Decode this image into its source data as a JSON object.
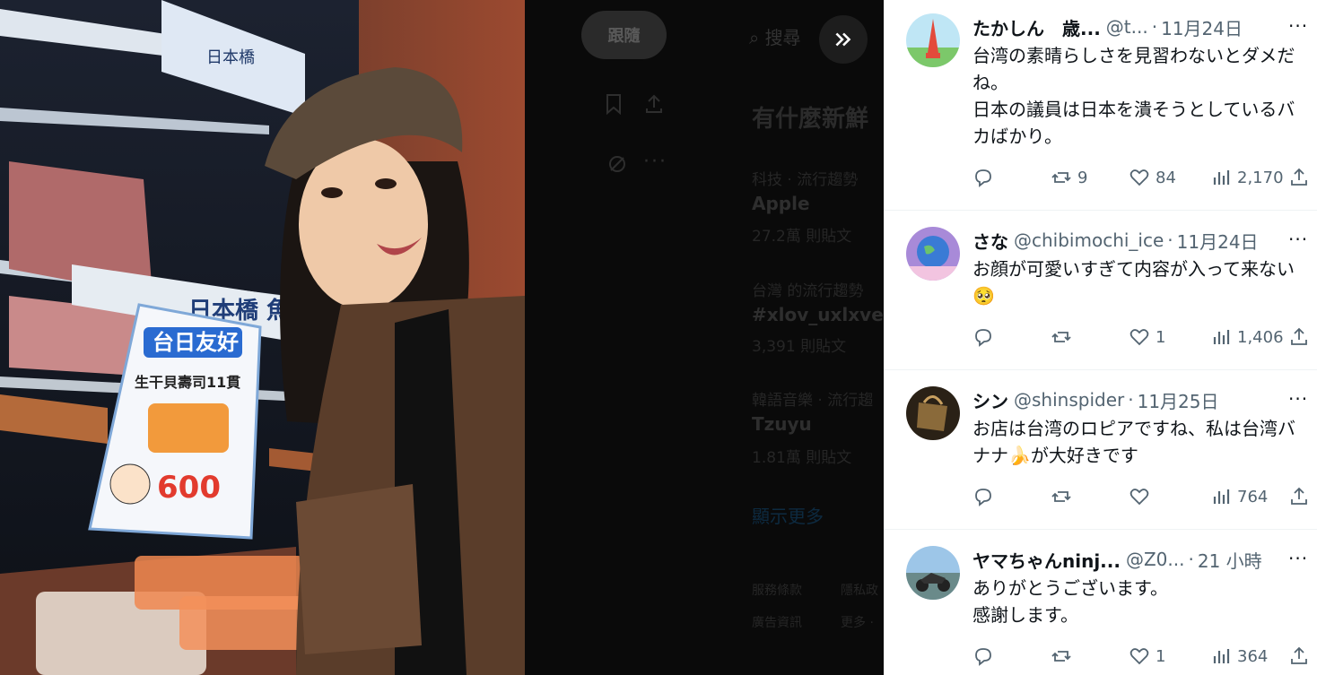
{
  "background": {
    "follow_button": "跟隨",
    "search_placeholder": "搜尋",
    "trends_title": "有什麼新鮮",
    "trends": [
      {
        "context": "科技 · 流行趨勢",
        "name": "Apple",
        "count": "27.2萬 則貼文"
      },
      {
        "context": "台灣 的流行趨勢",
        "name": "#xlov_uxlxve",
        "count": "3,391 則貼文"
      },
      {
        "context": "韓語音樂 · 流行趨",
        "name": "Tzuyu",
        "count": "1.81萬 則貼文"
      }
    ],
    "show_more": "顯示更多",
    "footer": [
      "服務條款",
      "隱私政",
      "廣告資訊",
      "更多 ·"
    ]
  },
  "photo": {
    "sign_title": "台日友好",
    "sign_sub": "生干貝壽司11貫",
    "sign_price": "600",
    "store_sign": "日本橋 魚萬"
  },
  "replies": [
    {
      "name": "たかしん　歳...",
      "handle": "@t...",
      "time": "11月24日",
      "text": "台湾の素晴らしさを見習わないとダメだね。\n日本の議員は日本を潰そうとしているバカばかり。",
      "retweets": "9",
      "likes": "84",
      "views": "2,170",
      "avatar_icon": "tokyo-tower-avatar"
    },
    {
      "name": "さな",
      "handle": "@chibimochi_ice",
      "time": "11月24日",
      "text": "お顔が可愛いすぎて内容が入って来ない🥺",
      "retweets": "",
      "likes": "1",
      "views": "1,406",
      "avatar_icon": "earth-avatar"
    },
    {
      "name": "シン",
      "handle": "@shinspider",
      "time": "11月25日",
      "text": "お店は台湾のロピアですね、私は台湾バナナ🍌が大好きです",
      "retweets": "",
      "likes": "",
      "views": "764",
      "avatar_icon": "bag-avatar"
    },
    {
      "name": "ヤマちゃんninj...",
      "handle": "@Z0...",
      "time": "21 小時",
      "text": "ありがとうございます。\n感謝します。",
      "retweets": "",
      "likes": "1",
      "views": "364",
      "avatar_icon": "motorcycle-avatar"
    }
  ],
  "colors": {
    "accent": "#1d9bf0",
    "text": "#0f1419",
    "secondary": "#536471"
  }
}
